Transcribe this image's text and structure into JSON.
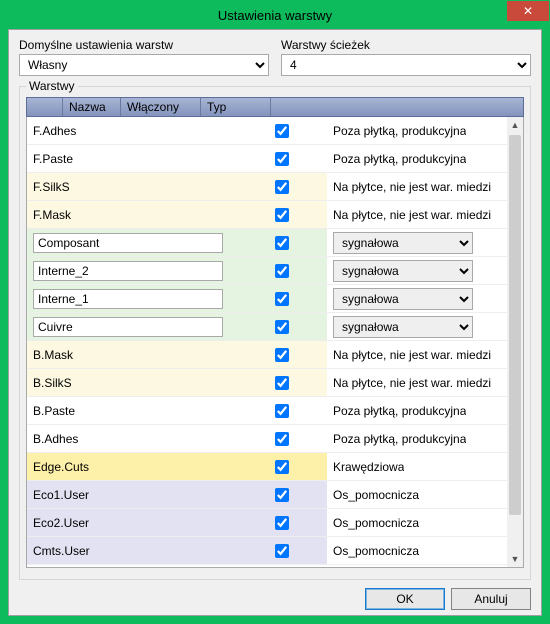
{
  "window": {
    "title": "Ustawienia warstwy",
    "close_glyph": "✕"
  },
  "top": {
    "preset_label": "Domyślne ustawienia warstw",
    "preset_value": "Własny",
    "tracks_label": "Warstwy ścieżek",
    "tracks_value": "4"
  },
  "group": {
    "title": "Warstwy",
    "headers": {
      "name": "Nazwa",
      "enabled": "Włączony",
      "type": "Typ"
    }
  },
  "type_options": [
    "sygnałowa"
  ],
  "rows": [
    {
      "name": "F.Adhes",
      "name_editable": false,
      "enabled": true,
      "tint": "",
      "type_text": "Poza płytką, produkcyjna",
      "type_dropdown": false
    },
    {
      "name": "F.Paste",
      "name_editable": false,
      "enabled": true,
      "tint": "",
      "type_text": "Poza płytką, produkcyjna",
      "type_dropdown": false
    },
    {
      "name": "F.SilkS",
      "name_editable": false,
      "enabled": true,
      "tint": "cream",
      "type_text": "Na płytce, nie jest war. miedzi",
      "type_dropdown": false
    },
    {
      "name": "F.Mask",
      "name_editable": false,
      "enabled": true,
      "tint": "cream",
      "type_text": "Na płytce, nie jest war. miedzi",
      "type_dropdown": false
    },
    {
      "name": "Composant",
      "name_editable": true,
      "enabled": true,
      "tint": "green",
      "type_text": "sygnałowa",
      "type_dropdown": true
    },
    {
      "name": "Interne_2",
      "name_editable": true,
      "enabled": true,
      "tint": "green",
      "type_text": "sygnałowa",
      "type_dropdown": true
    },
    {
      "name": "Interne_1",
      "name_editable": true,
      "enabled": true,
      "tint": "green",
      "type_text": "sygnałowa",
      "type_dropdown": true
    },
    {
      "name": "Cuivre",
      "name_editable": true,
      "enabled": true,
      "tint": "green",
      "type_text": "sygnałowa",
      "type_dropdown": true
    },
    {
      "name": "B.Mask",
      "name_editable": false,
      "enabled": true,
      "tint": "cream",
      "type_text": "Na płytce, nie jest war. miedzi",
      "type_dropdown": false
    },
    {
      "name": "B.SilkS",
      "name_editable": false,
      "enabled": true,
      "tint": "cream",
      "type_text": "Na płytce, nie jest war. miedzi",
      "type_dropdown": false
    },
    {
      "name": "B.Paste",
      "name_editable": false,
      "enabled": true,
      "tint": "",
      "type_text": "Poza płytką, produkcyjna",
      "type_dropdown": false
    },
    {
      "name": "B.Adhes",
      "name_editable": false,
      "enabled": true,
      "tint": "",
      "type_text": "Poza płytką, produkcyjna",
      "type_dropdown": false
    },
    {
      "name": "Edge.Cuts",
      "name_editable": false,
      "enabled": true,
      "tint": "yellow",
      "type_text": "Krawędziowa",
      "type_dropdown": false
    },
    {
      "name": "Eco1.User",
      "name_editable": false,
      "enabled": true,
      "tint": "violet",
      "type_text": "Os_pomocnicza",
      "type_dropdown": false
    },
    {
      "name": "Eco2.User",
      "name_editable": false,
      "enabled": true,
      "tint": "violet",
      "type_text": "Os_pomocnicza",
      "type_dropdown": false
    },
    {
      "name": "Cmts.User",
      "name_editable": false,
      "enabled": true,
      "tint": "violet",
      "type_text": "Os_pomocnicza",
      "type_dropdown": false
    }
  ],
  "buttons": {
    "ok": "OK",
    "cancel": "Anuluj"
  },
  "scroll": {
    "up": "▲",
    "down": "▼"
  }
}
